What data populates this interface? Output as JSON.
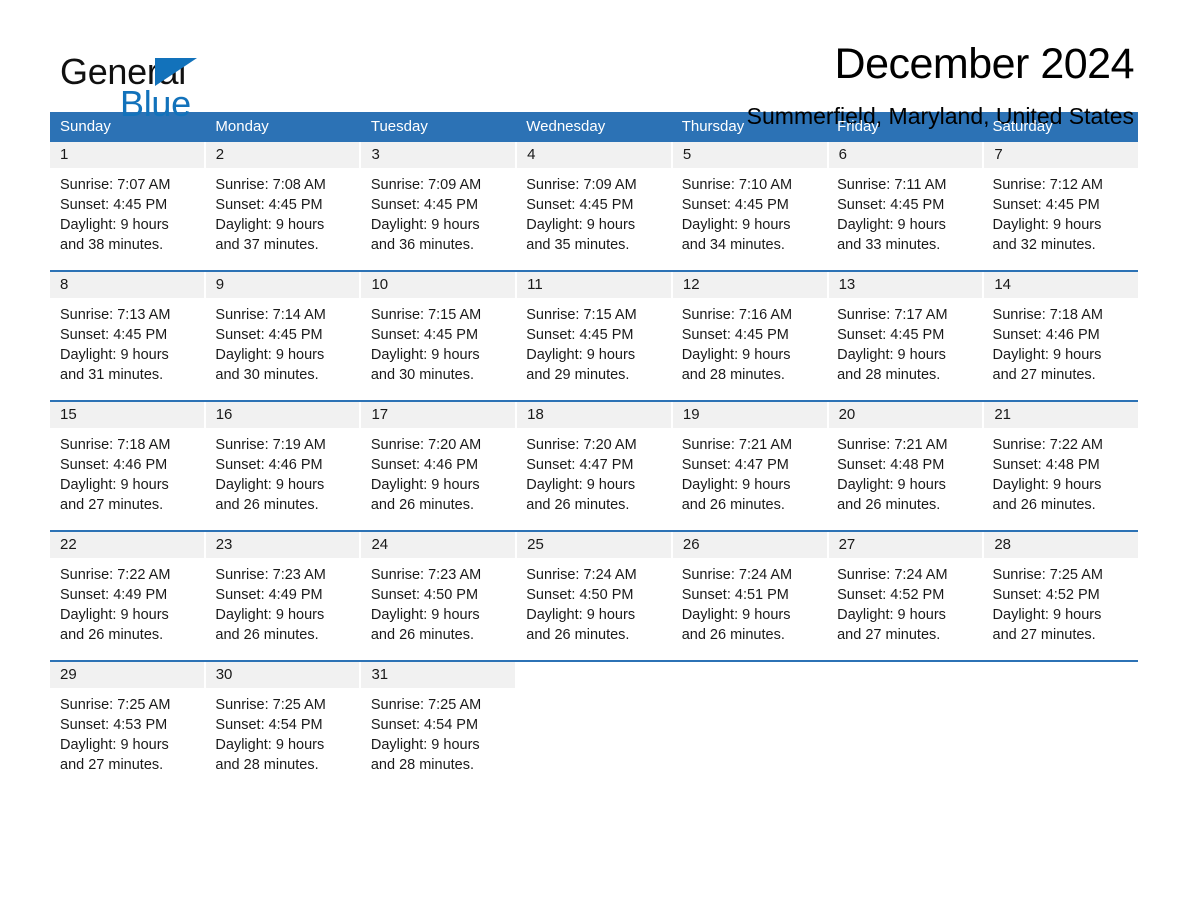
{
  "brand": {
    "name_top": "General",
    "name_bottom": "Blue",
    "color_black": "#111111",
    "color_blue": "#1272bb"
  },
  "header": {
    "title": "December 2024",
    "location": "Summerfield, Maryland, United States"
  },
  "theme": {
    "header_blue": "#2c72b5",
    "daynum_band": "#f1f1f1",
    "rule_blue": "#2c72b5",
    "text": "#1a1a1a",
    "page_bg": "#ffffff"
  },
  "calendar": {
    "weekday_headers": [
      "Sunday",
      "Monday",
      "Tuesday",
      "Wednesday",
      "Thursday",
      "Friday",
      "Saturday"
    ],
    "weeks": [
      {
        "days": [
          {
            "num": "1",
            "sunrise": "Sunrise: 7:07 AM",
            "sunset": "Sunset: 4:45 PM",
            "daylight1": "Daylight: 9 hours",
            "daylight2": "and 38 minutes."
          },
          {
            "num": "2",
            "sunrise": "Sunrise: 7:08 AM",
            "sunset": "Sunset: 4:45 PM",
            "daylight1": "Daylight: 9 hours",
            "daylight2": "and 37 minutes."
          },
          {
            "num": "3",
            "sunrise": "Sunrise: 7:09 AM",
            "sunset": "Sunset: 4:45 PM",
            "daylight1": "Daylight: 9 hours",
            "daylight2": "and 36 minutes."
          },
          {
            "num": "4",
            "sunrise": "Sunrise: 7:09 AM",
            "sunset": "Sunset: 4:45 PM",
            "daylight1": "Daylight: 9 hours",
            "daylight2": "and 35 minutes."
          },
          {
            "num": "5",
            "sunrise": "Sunrise: 7:10 AM",
            "sunset": "Sunset: 4:45 PM",
            "daylight1": "Daylight: 9 hours",
            "daylight2": "and 34 minutes."
          },
          {
            "num": "6",
            "sunrise": "Sunrise: 7:11 AM",
            "sunset": "Sunset: 4:45 PM",
            "daylight1": "Daylight: 9 hours",
            "daylight2": "and 33 minutes."
          },
          {
            "num": "7",
            "sunrise": "Sunrise: 7:12 AM",
            "sunset": "Sunset: 4:45 PM",
            "daylight1": "Daylight: 9 hours",
            "daylight2": "and 32 minutes."
          }
        ]
      },
      {
        "days": [
          {
            "num": "8",
            "sunrise": "Sunrise: 7:13 AM",
            "sunset": "Sunset: 4:45 PM",
            "daylight1": "Daylight: 9 hours",
            "daylight2": "and 31 minutes."
          },
          {
            "num": "9",
            "sunrise": "Sunrise: 7:14 AM",
            "sunset": "Sunset: 4:45 PM",
            "daylight1": "Daylight: 9 hours",
            "daylight2": "and 30 minutes."
          },
          {
            "num": "10",
            "sunrise": "Sunrise: 7:15 AM",
            "sunset": "Sunset: 4:45 PM",
            "daylight1": "Daylight: 9 hours",
            "daylight2": "and 30 minutes."
          },
          {
            "num": "11",
            "sunrise": "Sunrise: 7:15 AM",
            "sunset": "Sunset: 4:45 PM",
            "daylight1": "Daylight: 9 hours",
            "daylight2": "and 29 minutes."
          },
          {
            "num": "12",
            "sunrise": "Sunrise: 7:16 AM",
            "sunset": "Sunset: 4:45 PM",
            "daylight1": "Daylight: 9 hours",
            "daylight2": "and 28 minutes."
          },
          {
            "num": "13",
            "sunrise": "Sunrise: 7:17 AM",
            "sunset": "Sunset: 4:45 PM",
            "daylight1": "Daylight: 9 hours",
            "daylight2": "and 28 minutes."
          },
          {
            "num": "14",
            "sunrise": "Sunrise: 7:18 AM",
            "sunset": "Sunset: 4:46 PM",
            "daylight1": "Daylight: 9 hours",
            "daylight2": "and 27 minutes."
          }
        ]
      },
      {
        "days": [
          {
            "num": "15",
            "sunrise": "Sunrise: 7:18 AM",
            "sunset": "Sunset: 4:46 PM",
            "daylight1": "Daylight: 9 hours",
            "daylight2": "and 27 minutes."
          },
          {
            "num": "16",
            "sunrise": "Sunrise: 7:19 AM",
            "sunset": "Sunset: 4:46 PM",
            "daylight1": "Daylight: 9 hours",
            "daylight2": "and 26 minutes."
          },
          {
            "num": "17",
            "sunrise": "Sunrise: 7:20 AM",
            "sunset": "Sunset: 4:46 PM",
            "daylight1": "Daylight: 9 hours",
            "daylight2": "and 26 minutes."
          },
          {
            "num": "18",
            "sunrise": "Sunrise: 7:20 AM",
            "sunset": "Sunset: 4:47 PM",
            "daylight1": "Daylight: 9 hours",
            "daylight2": "and 26 minutes."
          },
          {
            "num": "19",
            "sunrise": "Sunrise: 7:21 AM",
            "sunset": "Sunset: 4:47 PM",
            "daylight1": "Daylight: 9 hours",
            "daylight2": "and 26 minutes."
          },
          {
            "num": "20",
            "sunrise": "Sunrise: 7:21 AM",
            "sunset": "Sunset: 4:48 PM",
            "daylight1": "Daylight: 9 hours",
            "daylight2": "and 26 minutes."
          },
          {
            "num": "21",
            "sunrise": "Sunrise: 7:22 AM",
            "sunset": "Sunset: 4:48 PM",
            "daylight1": "Daylight: 9 hours",
            "daylight2": "and 26 minutes."
          }
        ]
      },
      {
        "days": [
          {
            "num": "22",
            "sunrise": "Sunrise: 7:22 AM",
            "sunset": "Sunset: 4:49 PM",
            "daylight1": "Daylight: 9 hours",
            "daylight2": "and 26 minutes."
          },
          {
            "num": "23",
            "sunrise": "Sunrise: 7:23 AM",
            "sunset": "Sunset: 4:49 PM",
            "daylight1": "Daylight: 9 hours",
            "daylight2": "and 26 minutes."
          },
          {
            "num": "24",
            "sunrise": "Sunrise: 7:23 AM",
            "sunset": "Sunset: 4:50 PM",
            "daylight1": "Daylight: 9 hours",
            "daylight2": "and 26 minutes."
          },
          {
            "num": "25",
            "sunrise": "Sunrise: 7:24 AM",
            "sunset": "Sunset: 4:50 PM",
            "daylight1": "Daylight: 9 hours",
            "daylight2": "and 26 minutes."
          },
          {
            "num": "26",
            "sunrise": "Sunrise: 7:24 AM",
            "sunset": "Sunset: 4:51 PM",
            "daylight1": "Daylight: 9 hours",
            "daylight2": "and 26 minutes."
          },
          {
            "num": "27",
            "sunrise": "Sunrise: 7:24 AM",
            "sunset": "Sunset: 4:52 PM",
            "daylight1": "Daylight: 9 hours",
            "daylight2": "and 27 minutes."
          },
          {
            "num": "28",
            "sunrise": "Sunrise: 7:25 AM",
            "sunset": "Sunset: 4:52 PM",
            "daylight1": "Daylight: 9 hours",
            "daylight2": "and 27 minutes."
          }
        ]
      },
      {
        "days": [
          {
            "num": "29",
            "sunrise": "Sunrise: 7:25 AM",
            "sunset": "Sunset: 4:53 PM",
            "daylight1": "Daylight: 9 hours",
            "daylight2": "and 27 minutes."
          },
          {
            "num": "30",
            "sunrise": "Sunrise: 7:25 AM",
            "sunset": "Sunset: 4:54 PM",
            "daylight1": "Daylight: 9 hours",
            "daylight2": "and 28 minutes."
          },
          {
            "num": "31",
            "sunrise": "Sunrise: 7:25 AM",
            "sunset": "Sunset: 4:54 PM",
            "daylight1": "Daylight: 9 hours",
            "daylight2": "and 28 minutes."
          },
          {
            "num": "",
            "sunrise": "",
            "sunset": "",
            "daylight1": "",
            "daylight2": ""
          },
          {
            "num": "",
            "sunrise": "",
            "sunset": "",
            "daylight1": "",
            "daylight2": ""
          },
          {
            "num": "",
            "sunrise": "",
            "sunset": "",
            "daylight1": "",
            "daylight2": ""
          },
          {
            "num": "",
            "sunrise": "",
            "sunset": "",
            "daylight1": "",
            "daylight2": ""
          }
        ]
      }
    ]
  }
}
